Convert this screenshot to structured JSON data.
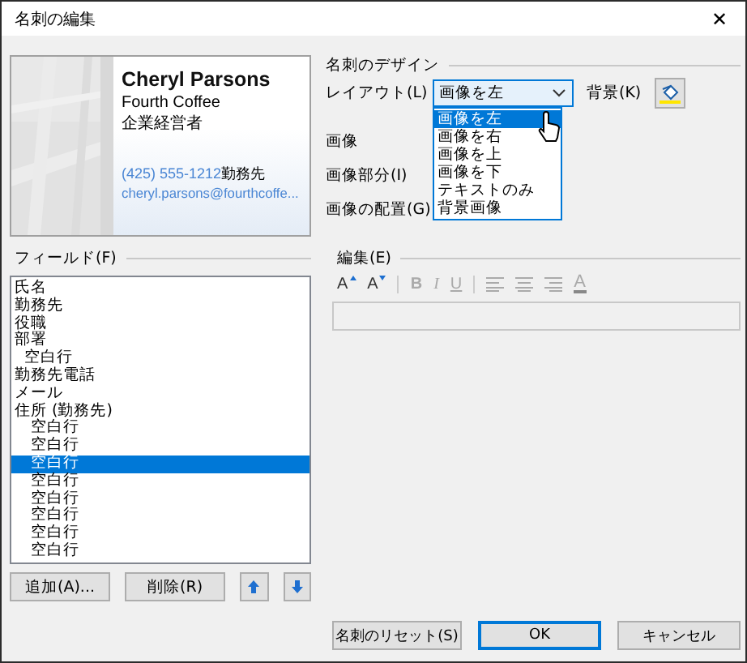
{
  "window": {
    "title": "名刺の編集",
    "close": "✕"
  },
  "card": {
    "name": "Cheryl Parsons",
    "company": "Fourth Coffee",
    "job_title": "企業経営者",
    "phone": "(425) 555-1212",
    "phone_label": "勤務先",
    "email": "cheryl.parsons@fourthcoffe..."
  },
  "design": {
    "title": "名刺のデザイン",
    "layout_label": "レイアウト(L)",
    "layout_value": "画像を左",
    "layout_options": [
      {
        "label": "画像を左",
        "selected": true
      },
      {
        "label": "画像を右",
        "selected": false
      },
      {
        "label": "画像を上",
        "selected": false
      },
      {
        "label": "画像を下",
        "selected": false
      },
      {
        "label": "テキストのみ",
        "selected": false
      },
      {
        "label": "背景画像",
        "selected": false
      }
    ],
    "background_label": "背景(K)",
    "image_label": "画像",
    "image_area_label": "画像部分(I)",
    "image_position_label": "画像の配置(G)"
  },
  "fields": {
    "title": "フィールド(F)",
    "items": [
      {
        "label": "氏名",
        "selected": false
      },
      {
        "label": "勤務先",
        "selected": false
      },
      {
        "label": "役職",
        "selected": false
      },
      {
        "label": "部署",
        "selected": false,
        "children": [
          {
            "label": "空白行",
            "selected": false
          }
        ]
      },
      {
        "label": "勤務先電話",
        "selected": false
      },
      {
        "label": "メール",
        "selected": false
      },
      {
        "label": "住所 (勤務先)",
        "selected": false,
        "children": [
          {
            "label": "空白行",
            "selected": false
          },
          {
            "label": "空白行",
            "selected": false
          },
          {
            "label": "空白行",
            "selected": true
          },
          {
            "label": "空白行",
            "selected": false
          },
          {
            "label": "空白行",
            "selected": false
          },
          {
            "label": "空白行",
            "selected": false
          },
          {
            "label": "空白行",
            "selected": false
          },
          {
            "label": "空白行",
            "selected": false
          }
        ]
      }
    ]
  },
  "edit": {
    "title": "編集(E)",
    "toolbar": [
      {
        "kind": "grow",
        "label": "A",
        "disabled": false
      },
      {
        "kind": "shrink",
        "label": "A",
        "disabled": false
      },
      {
        "kind": "bold",
        "label": "B",
        "disabled": true
      },
      {
        "kind": "italic",
        "label": "I",
        "disabled": true
      },
      {
        "kind": "underline",
        "label": "U",
        "disabled": true
      },
      {
        "kind": "align_left",
        "disabled": true
      },
      {
        "kind": "align_center",
        "disabled": true
      },
      {
        "kind": "align_right",
        "disabled": true
      },
      {
        "kind": "color",
        "label": "A",
        "disabled": true
      }
    ]
  },
  "list_buttons": [
    {
      "kind": "text",
      "label": "追加(A)..."
    },
    {
      "kind": "text",
      "label": "削除(R)"
    },
    {
      "kind": "up"
    },
    {
      "kind": "down"
    }
  ],
  "buttons": [
    {
      "label": "名刺のリセット(S)",
      "default": false
    },
    {
      "label": "OK",
      "default": true
    },
    {
      "label": "キャンセル",
      "default": false
    }
  ]
}
